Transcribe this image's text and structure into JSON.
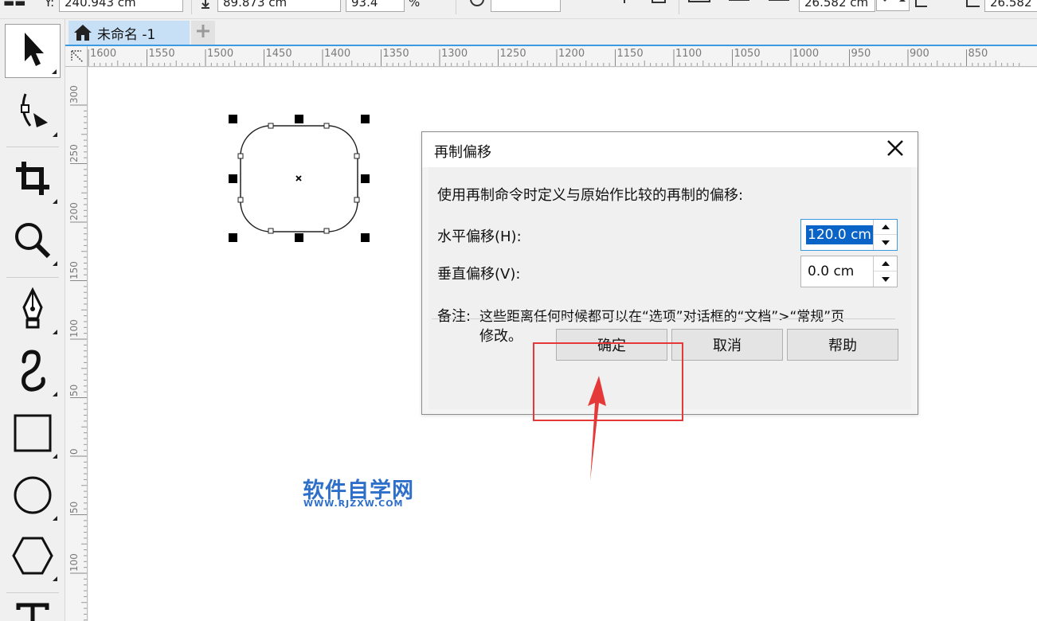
{
  "property_bar": {
    "y_label": "Y:",
    "y_value": "240.943 cm",
    "height_value": "89.873 cm",
    "scale_value": "93.4",
    "percent_label": "%",
    "size_value_1": "26.582 cm",
    "size_value_2": "26.582"
  },
  "document_tab": {
    "label": "未命名 -1"
  },
  "horizontal_ruler": {
    "labels": [
      "1600",
      "1550",
      "1500",
      "1450",
      "1400",
      "1350",
      "1300",
      "1250",
      "1200",
      "1150",
      "1100",
      "1050",
      "1000",
      "950",
      "900",
      "850"
    ]
  },
  "vertical_ruler": {
    "labels": [
      "300",
      "250",
      "200",
      "150",
      "100",
      "50",
      "0",
      "50",
      "100"
    ]
  },
  "dialog": {
    "title": "再制偏移",
    "description": "使用再制命令时定义与原始作比较的再制的偏移:",
    "horizontal_label": "水平偏移(H):",
    "horizontal_value": "120.0 cm",
    "vertical_label": "垂直偏移(V):",
    "vertical_value": "0.0 cm",
    "note_label": "备注:",
    "note_line1": "这些距离任何时候都可以在“选项”对话框的“文档”>“常规”页",
    "note_line2": "修改。",
    "ok_label": "确定",
    "cancel_label": "取消",
    "help_label": "帮助"
  },
  "watermark": {
    "title": "软件自学网",
    "url": "WWW.RJZXW.COM"
  },
  "colors": {
    "accent": "#3c9be0",
    "selection": "#0a64c8",
    "highlight": "#e53838",
    "watermark": "#2e6fc9"
  },
  "icons": [
    "pick-tool-icon",
    "shape-tool-icon",
    "crop-tool-icon",
    "zoom-tool-icon",
    "pen-tool-icon",
    "artistic-media-icon",
    "rectangle-tool-icon",
    "ellipse-tool-icon",
    "polygon-tool-icon",
    "text-tool-icon",
    "home-icon",
    "add-tab-icon",
    "close-icon"
  ]
}
